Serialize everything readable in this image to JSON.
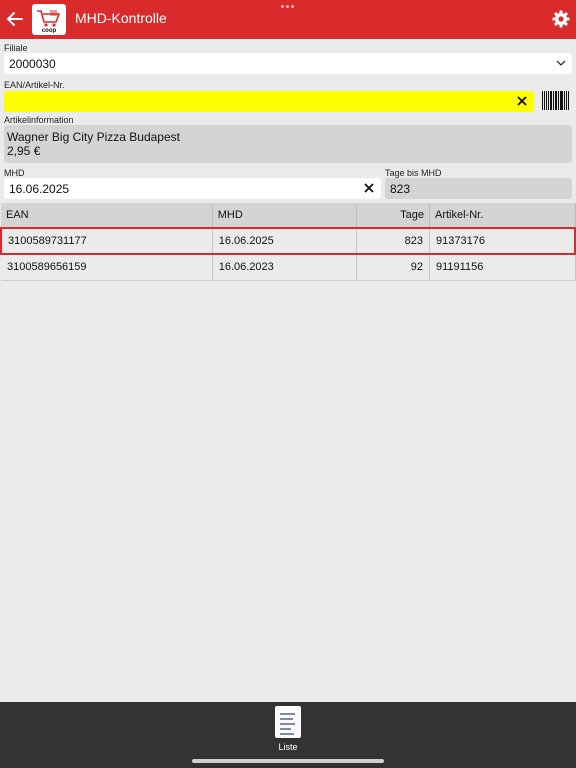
{
  "header": {
    "title": "MHD-Kontrolle",
    "colors": {
      "accent": "#d92b2b"
    }
  },
  "form": {
    "filiale_label": "Filiale",
    "filiale_value": "2000030",
    "ean_label": "EAN/Artikel-Nr.",
    "ean_value": "",
    "artikelinfo_label": "Artikelinformation",
    "artikelinfo_name": "Wagner Big City Pizza Budapest",
    "artikelinfo_price": "2,95 €",
    "mhd_label": "MHD",
    "mhd_value": "16.06.2025",
    "tage_label": "Tage bis MHD",
    "tage_value": "823"
  },
  "table": {
    "headers": [
      "EAN",
      "MHD",
      "Tage",
      "Artikel-Nr."
    ],
    "rows": [
      {
        "ean": "3100589731177",
        "mhd": "16.06.2025",
        "tage": "823",
        "artikel": "91373176",
        "selected": true
      },
      {
        "ean": "3100589656159",
        "mhd": "16.06.2023",
        "tage": "92",
        "artikel": "91191156",
        "selected": false
      }
    ]
  },
  "bottom_bar": {
    "liste_label": "Liste",
    "icon": "list-icon"
  }
}
